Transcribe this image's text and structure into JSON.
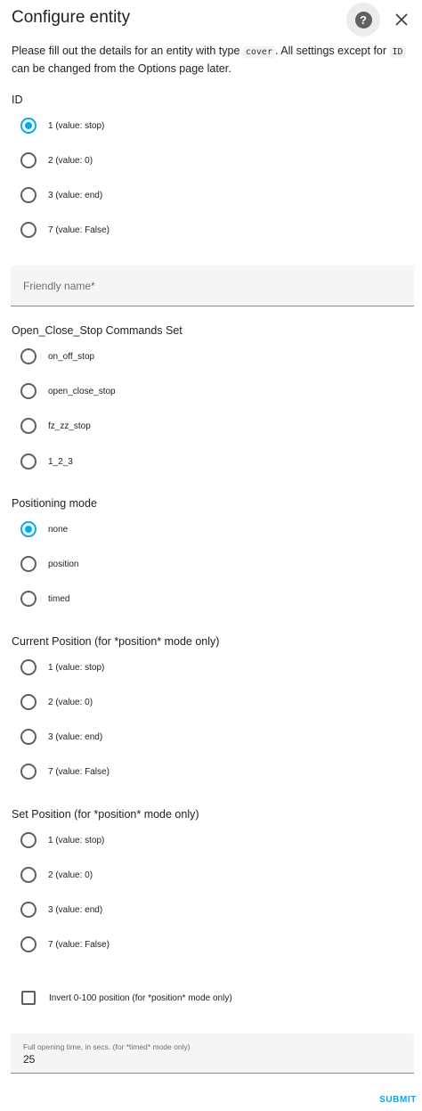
{
  "dialog": {
    "title": "Configure entity",
    "help_icon": "help-circle-icon",
    "close_icon": "close-icon"
  },
  "description": {
    "part1": "Please fill out the details for an entity with type ",
    "code1": "cover",
    "part2": ". All settings except for ",
    "code2": "ID",
    "part3": " can be changed from the Options page later."
  },
  "id_group": {
    "label": "ID",
    "options": [
      "1 (value: stop)",
      "2 (value: 0)",
      "3 (value: end)",
      "7 (value: False)"
    ],
    "selected": 0
  },
  "friendly_name": {
    "placeholder": "Friendly name*",
    "value": ""
  },
  "commands_group": {
    "label": "Open_Close_Stop Commands Set",
    "options": [
      "on_off_stop",
      "open_close_stop",
      "fz_zz_stop",
      "1_2_3"
    ],
    "selected": null
  },
  "positioning_group": {
    "label": "Positioning mode",
    "options": [
      "none",
      "position",
      "timed"
    ],
    "selected": 0
  },
  "current_position_group": {
    "label": "Current Position (for *position* mode only)",
    "options": [
      "1 (value: stop)",
      "2 (value: 0)",
      "3 (value: end)",
      "7 (value: False)"
    ],
    "selected": null
  },
  "set_position_group": {
    "label": "Set Position (for *position* mode only)",
    "options": [
      "1 (value: stop)",
      "2 (value: 0)",
      "3 (value: end)",
      "7 (value: False)"
    ],
    "selected": null
  },
  "invert": {
    "label": "Invert 0-100 position (for *position* mode only)",
    "checked": false
  },
  "opening_time": {
    "label": "Full opening time, in secs. (for *timed* mode only)",
    "value": "25"
  },
  "submit_label": "SUBMIT",
  "colors": {
    "accent": "#03a9f4",
    "radio_border": "#5f5f5f",
    "field_bg": "#f5f5f5"
  }
}
